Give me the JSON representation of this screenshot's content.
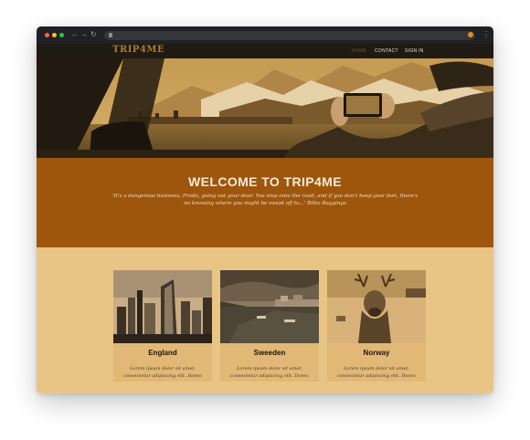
{
  "site": {
    "logo": "TRIP4ME",
    "nav": [
      "HOME",
      "CONTACT",
      "SIGN IN"
    ]
  },
  "welcome": {
    "title": "WELCOME TO TRIP4ME",
    "quote": "'It's a dangerous business, Frodo, going out your door. You step onto the road, and if you don't keep your feet, there's no knowing where you might be swept off to...' Bilbo Baggings"
  },
  "destinations": [
    {
      "name": "England",
      "text": "Lorem ipsum dolor sit amet, consectetur adipiscing elit. Donec"
    },
    {
      "name": "Sweeden",
      "text": "Lorem ipsum dolor sit amet, consectetur adipiscing elit. Donec"
    },
    {
      "name": "Norway",
      "text": "Lorem ipsum dolor sit amet, consectetur adipiscing elit. Donec"
    }
  ],
  "colors": {
    "accent": "#9e560c",
    "background": "#e9c585",
    "card": "#e2b877",
    "nav": "#1f1a12"
  }
}
